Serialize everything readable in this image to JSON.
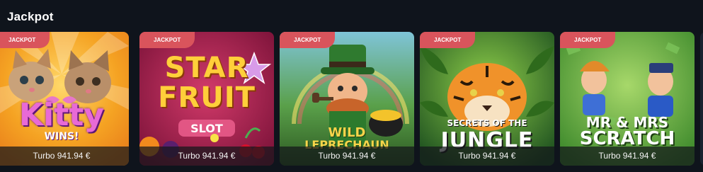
{
  "section": {
    "title": "Jackpot"
  },
  "games": [
    {
      "name": "Kitty Wins!",
      "badge": "JACKPOT",
      "jackpot": "Turbo 941.94 €",
      "title_line1": "Kitty",
      "title_line2": "WINS!"
    },
    {
      "name": "Star Fruit Slot",
      "badge": "JACKPOT",
      "jackpot": "Turbo 941.94 €",
      "title_line1": "STAR",
      "title_line2": "FRUIT",
      "title_line3": "SLOT"
    },
    {
      "name": "Wild Leprechaun",
      "badge": "JACKPOT",
      "jackpot": "Turbo 941.94 €",
      "title_line1": "WILD",
      "title_line2": "LEPRECHAUN"
    },
    {
      "name": "Secrets of the Jungle",
      "badge": "JACKPOT",
      "jackpot": "Turbo 941.94 €",
      "title_line1": "SECRETS OF THE",
      "title_line2": "JUNGLE"
    },
    {
      "name": "Mr & Mrs Scratch",
      "badge": "JACKPOT",
      "jackpot": "Turbo 941.94 €",
      "title_line1": "MR & MRS",
      "title_line2": "SCRATCH"
    }
  ],
  "colors": {
    "background": "#0f141c",
    "badge": "#d9545c"
  }
}
